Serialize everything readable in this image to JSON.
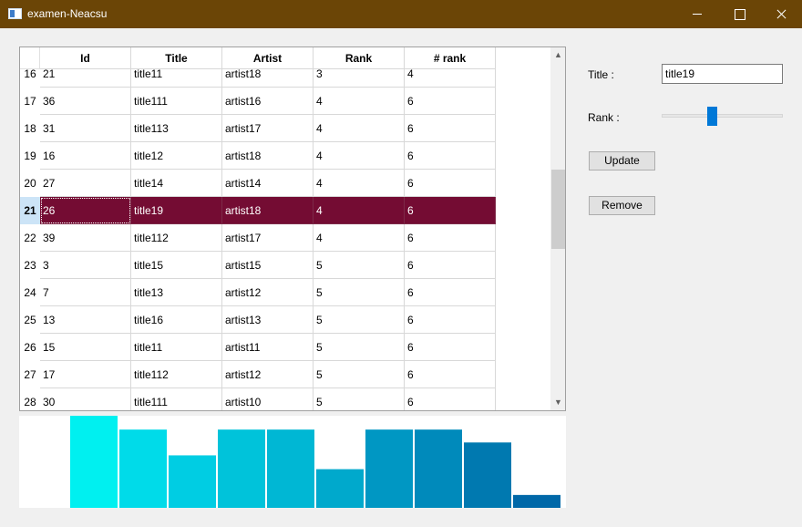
{
  "window": {
    "title": "examen-Neacsu"
  },
  "table": {
    "columns": [
      "Id",
      "Title",
      "Artist",
      "Rank",
      "# rank"
    ],
    "selected_row_label": "21",
    "rows": [
      {
        "label": "16",
        "cells": [
          "21",
          "title11",
          "artist18",
          "3",
          "4"
        ]
      },
      {
        "label": "17",
        "cells": [
          "36",
          "title111",
          "artist16",
          "4",
          "6"
        ]
      },
      {
        "label": "18",
        "cells": [
          "31",
          "title113",
          "artist17",
          "4",
          "6"
        ]
      },
      {
        "label": "19",
        "cells": [
          "16",
          "title12",
          "artist18",
          "4",
          "6"
        ]
      },
      {
        "label": "20",
        "cells": [
          "27",
          "title14",
          "artist14",
          "4",
          "6"
        ]
      },
      {
        "label": "21",
        "cells": [
          "26",
          "title19",
          "artist18",
          "4",
          "6"
        ]
      },
      {
        "label": "22",
        "cells": [
          "39",
          "title112",
          "artist17",
          "4",
          "6"
        ]
      },
      {
        "label": "23",
        "cells": [
          "3",
          "title15",
          "artist15",
          "5",
          "6"
        ]
      },
      {
        "label": "24",
        "cells": [
          "7",
          "title13",
          "artist12",
          "5",
          "6"
        ]
      },
      {
        "label": "25",
        "cells": [
          "13",
          "title16",
          "artist13",
          "5",
          "6"
        ]
      },
      {
        "label": "26",
        "cells": [
          "15",
          "title11",
          "artist11",
          "5",
          "6"
        ]
      },
      {
        "label": "27",
        "cells": [
          "17",
          "title112",
          "artist12",
          "5",
          "6"
        ]
      },
      {
        "label": "28",
        "cells": [
          "30",
          "title111",
          "artist10",
          "5",
          "6"
        ]
      }
    ]
  },
  "form": {
    "title_label": "Title :",
    "title_value": "title19",
    "rank_label": "Rank :",
    "rank_slider_fraction": 0.41,
    "update_label": "Update",
    "remove_label": "Remove"
  },
  "chart_data": {
    "type": "bar",
    "values": [
      100,
      85,
      57,
      85,
      85,
      42,
      85,
      85,
      71,
      14
    ],
    "ylim": [
      0,
      100
    ],
    "colors": [
      "#00f0f0",
      "#00dbe9",
      "#00cde3",
      "#00c3da",
      "#00b7d4",
      "#00a9cc",
      "#0097c3",
      "#008abb",
      "#0079b0",
      "#0068a8"
    ],
    "grid": false
  },
  "colors": {
    "titlebar": "#6b4506",
    "selection": "#740c33",
    "slider": "#0078d7"
  }
}
